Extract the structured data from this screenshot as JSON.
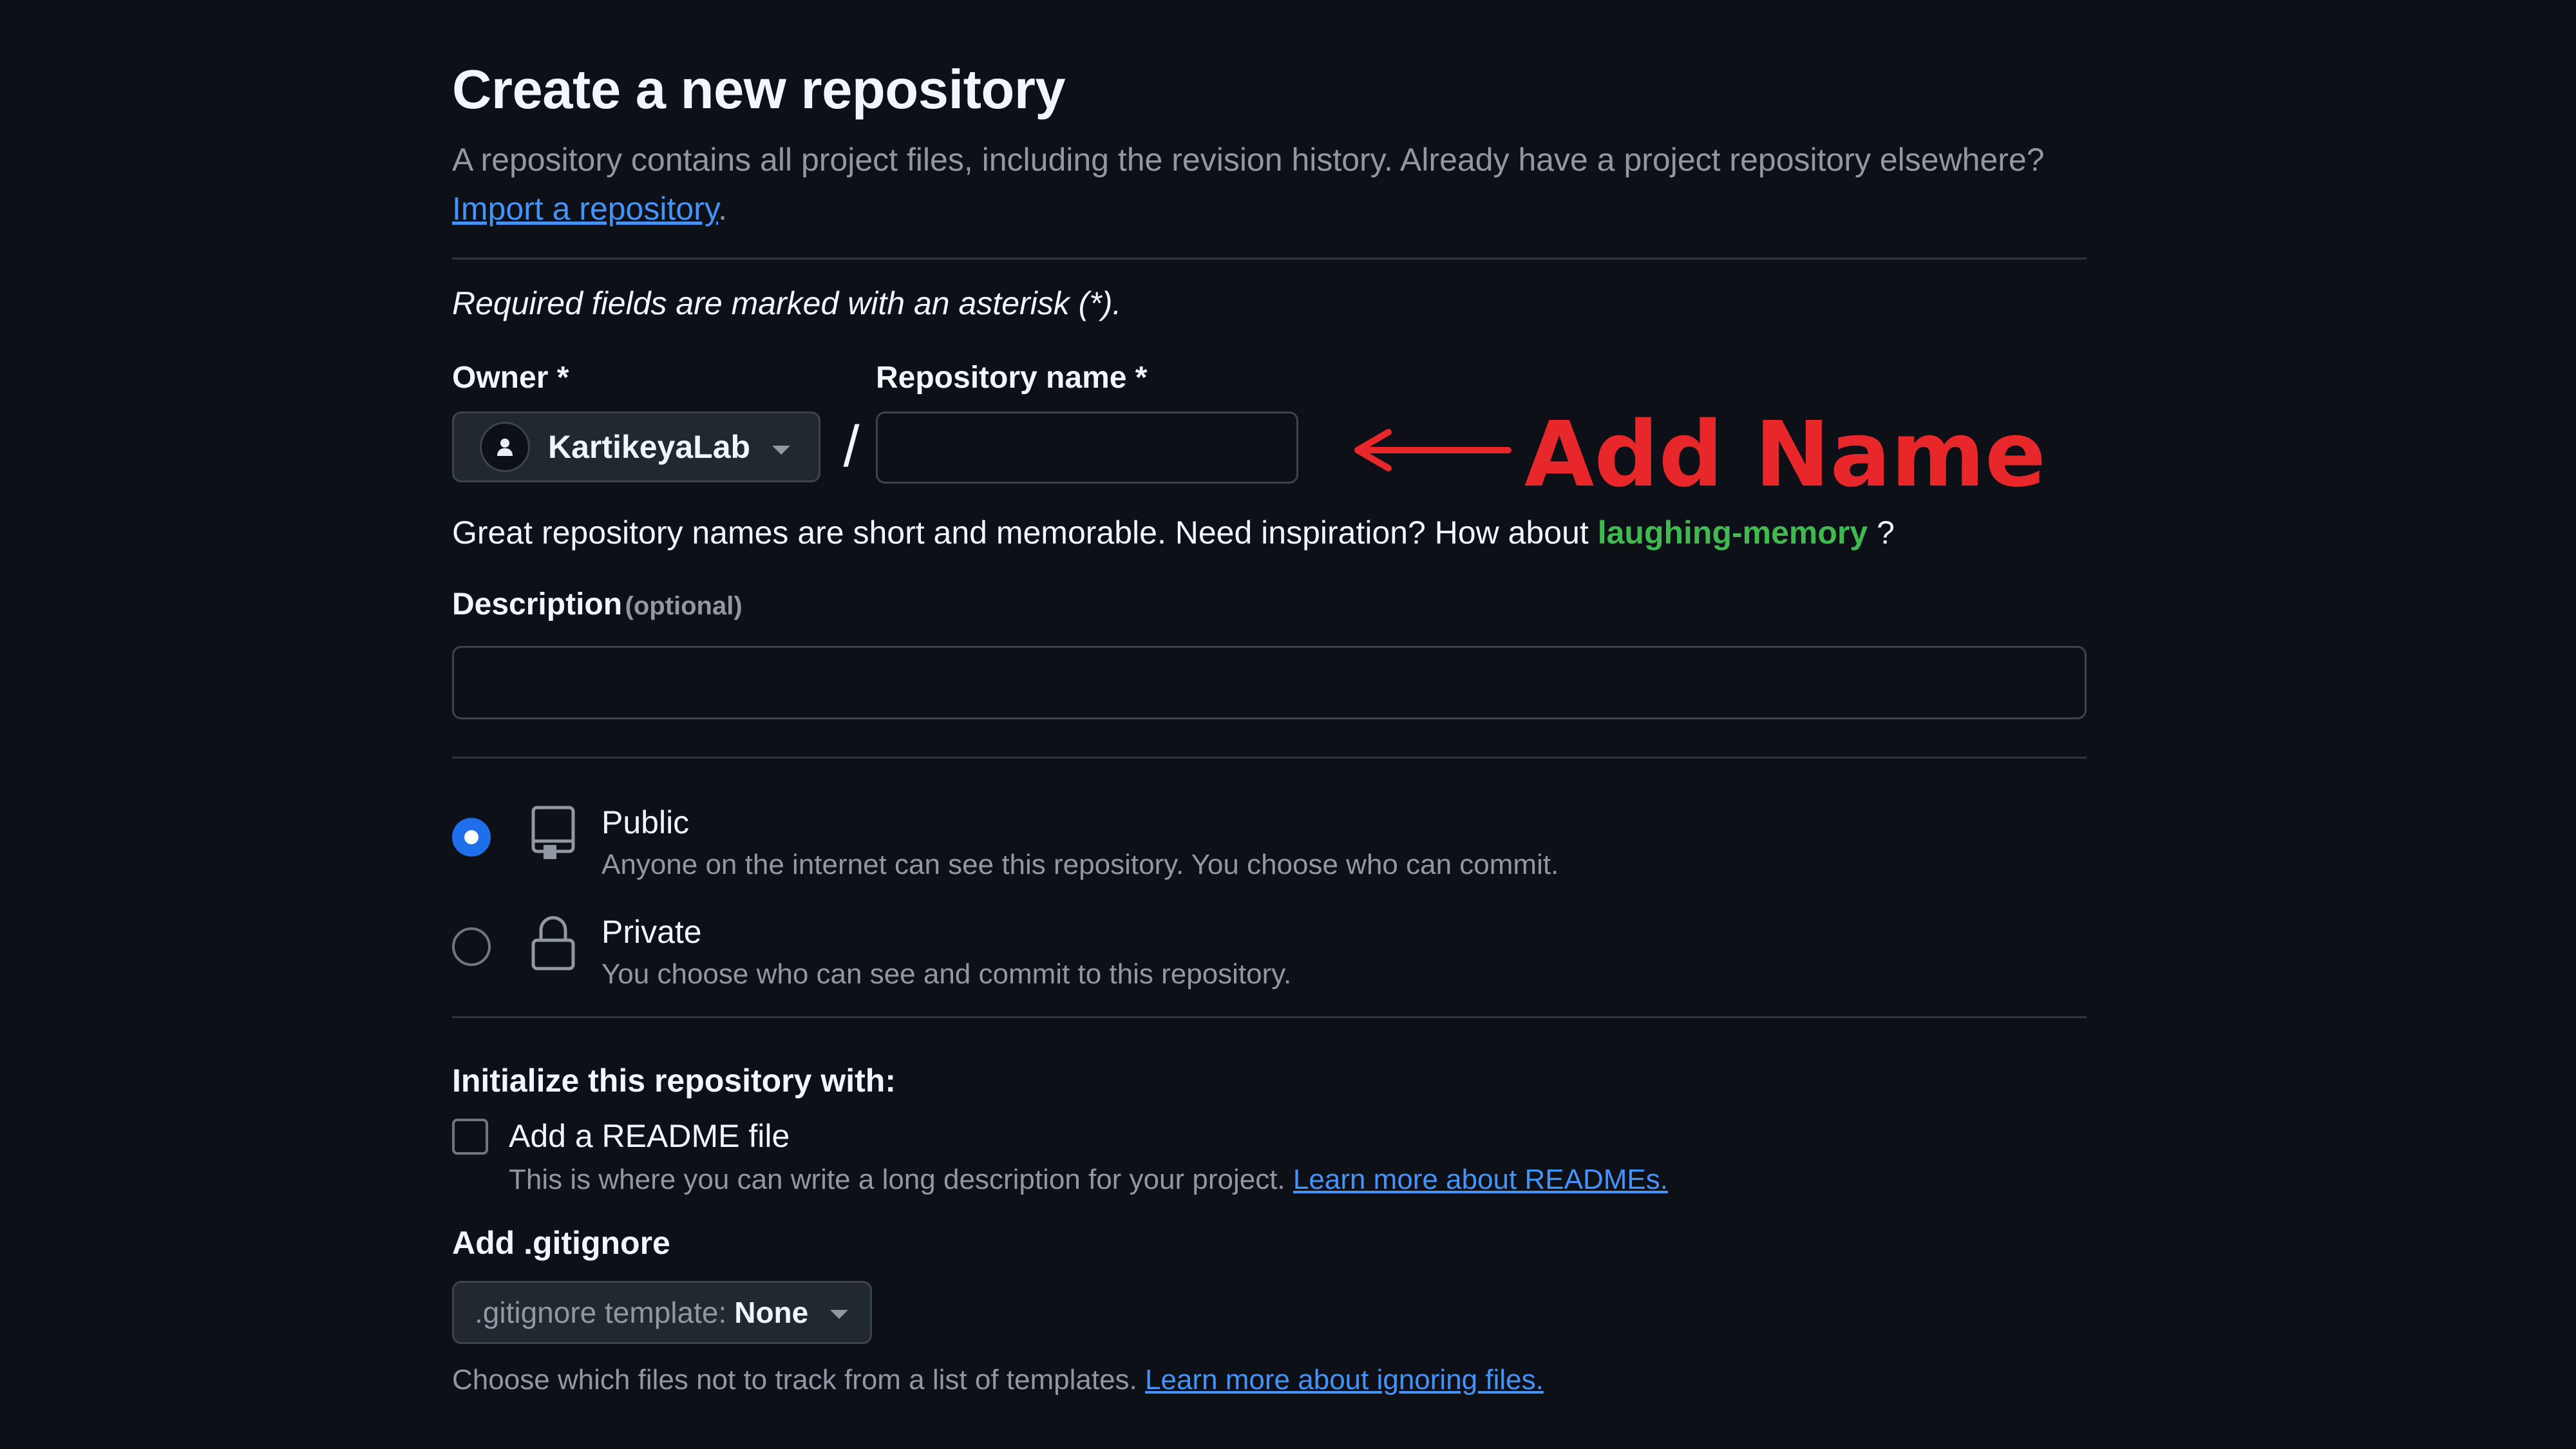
{
  "header": {
    "title": "Create a new repository",
    "intro_text": "A repository contains all project files, including the revision history. Already have a project repository elsewhere?",
    "import_link": "Import a repository",
    "intro_end": "."
  },
  "required_note": "Required fields are marked with an asterisk (*).",
  "owner": {
    "label": "Owner *",
    "selected": "KartikeyaLab"
  },
  "separator": "/",
  "repo_name": {
    "label": "Repository name *",
    "value": ""
  },
  "annotation": {
    "text": "Add Name",
    "color": "#e8272a"
  },
  "name_hint": {
    "text": "Great repository names are short and memorable. Need inspiration? How about",
    "suggestion": "laughing-memory",
    "end": "?"
  },
  "description": {
    "label": "Description",
    "optional": "(optional)",
    "value": ""
  },
  "visibility": {
    "selected": "Public",
    "options": [
      {
        "title": "Public",
        "desc": "Anyone on the internet can see this repository. You choose who can commit.",
        "icon": "repo-icon"
      },
      {
        "title": "Private",
        "desc": "You choose who can see and commit to this repository.",
        "icon": "lock-icon"
      }
    ]
  },
  "initialize": {
    "title": "Initialize this repository with:",
    "readme_label": "Add a README file",
    "readme_checked": false,
    "readme_desc": "This is where you can write a long description for your project.",
    "readme_link": "Learn more about READMEs."
  },
  "gitignore": {
    "title": "Add .gitignore",
    "select_prefix": ".gitignore template:",
    "select_value": "None",
    "desc": "Choose which files not to track from a list of templates.",
    "link": "Learn more about ignoring files."
  },
  "colors": {
    "background": "#0d1117",
    "accent": "#1f6feb",
    "link": "#4493f8",
    "success": "#3fb950"
  }
}
